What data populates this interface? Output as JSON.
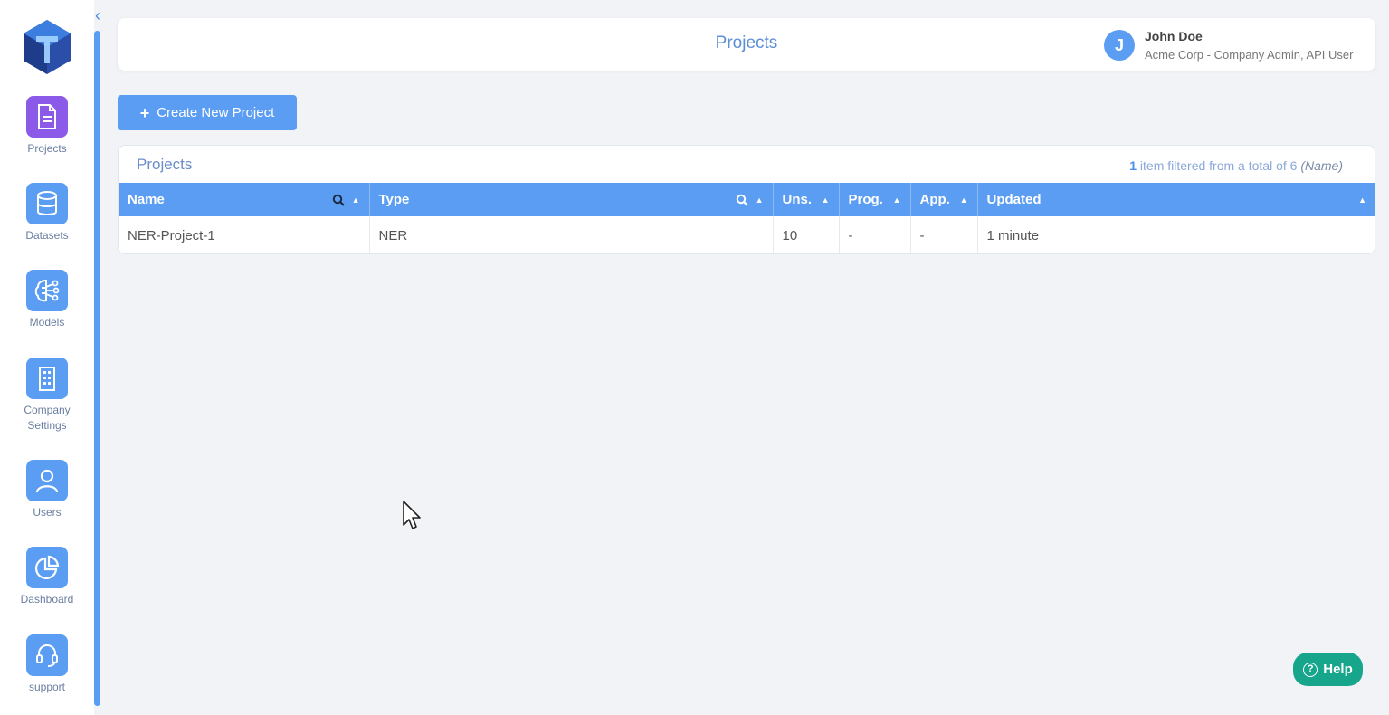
{
  "sidebar": {
    "collapse_icon": "chevron-left-icon",
    "items": [
      {
        "label": "Projects",
        "icon": "document-icon",
        "active": true
      },
      {
        "label": "Datasets",
        "icon": "database-icon"
      },
      {
        "label": "Models",
        "icon": "brain-network-icon"
      },
      {
        "label": "Company\nSettings",
        "icon": "building-icon"
      },
      {
        "label": "Users",
        "icon": "user-icon"
      },
      {
        "label": "Dashboard",
        "icon": "pie-chart-icon"
      },
      {
        "label": "support",
        "icon": "headset-icon"
      }
    ]
  },
  "header": {
    "title": "Projects",
    "user": {
      "initial": "J",
      "name": "John Doe",
      "role": "Acme Corp - Company Admin, API User"
    }
  },
  "toolbar": {
    "create_label": "Create New Project"
  },
  "projects_panel": {
    "title": "Projects",
    "filter_count": "1",
    "filter_text": " item filtered from a total of 6 ",
    "filter_field": "(Name)",
    "columns": [
      "Name",
      "Type",
      "Uns.",
      "Prog.",
      "App.",
      "Updated"
    ],
    "rows": [
      {
        "name": "NER-Project-1",
        "type": "NER",
        "uns": "10",
        "prog": "-",
        "app": "-",
        "updated": "1 minute"
      }
    ]
  },
  "help": {
    "icon_text": "?",
    "label": "Help"
  },
  "colors": {
    "accent": "#5a9df2",
    "active_nav": "#8c5ae8",
    "help": "#17a58c"
  }
}
